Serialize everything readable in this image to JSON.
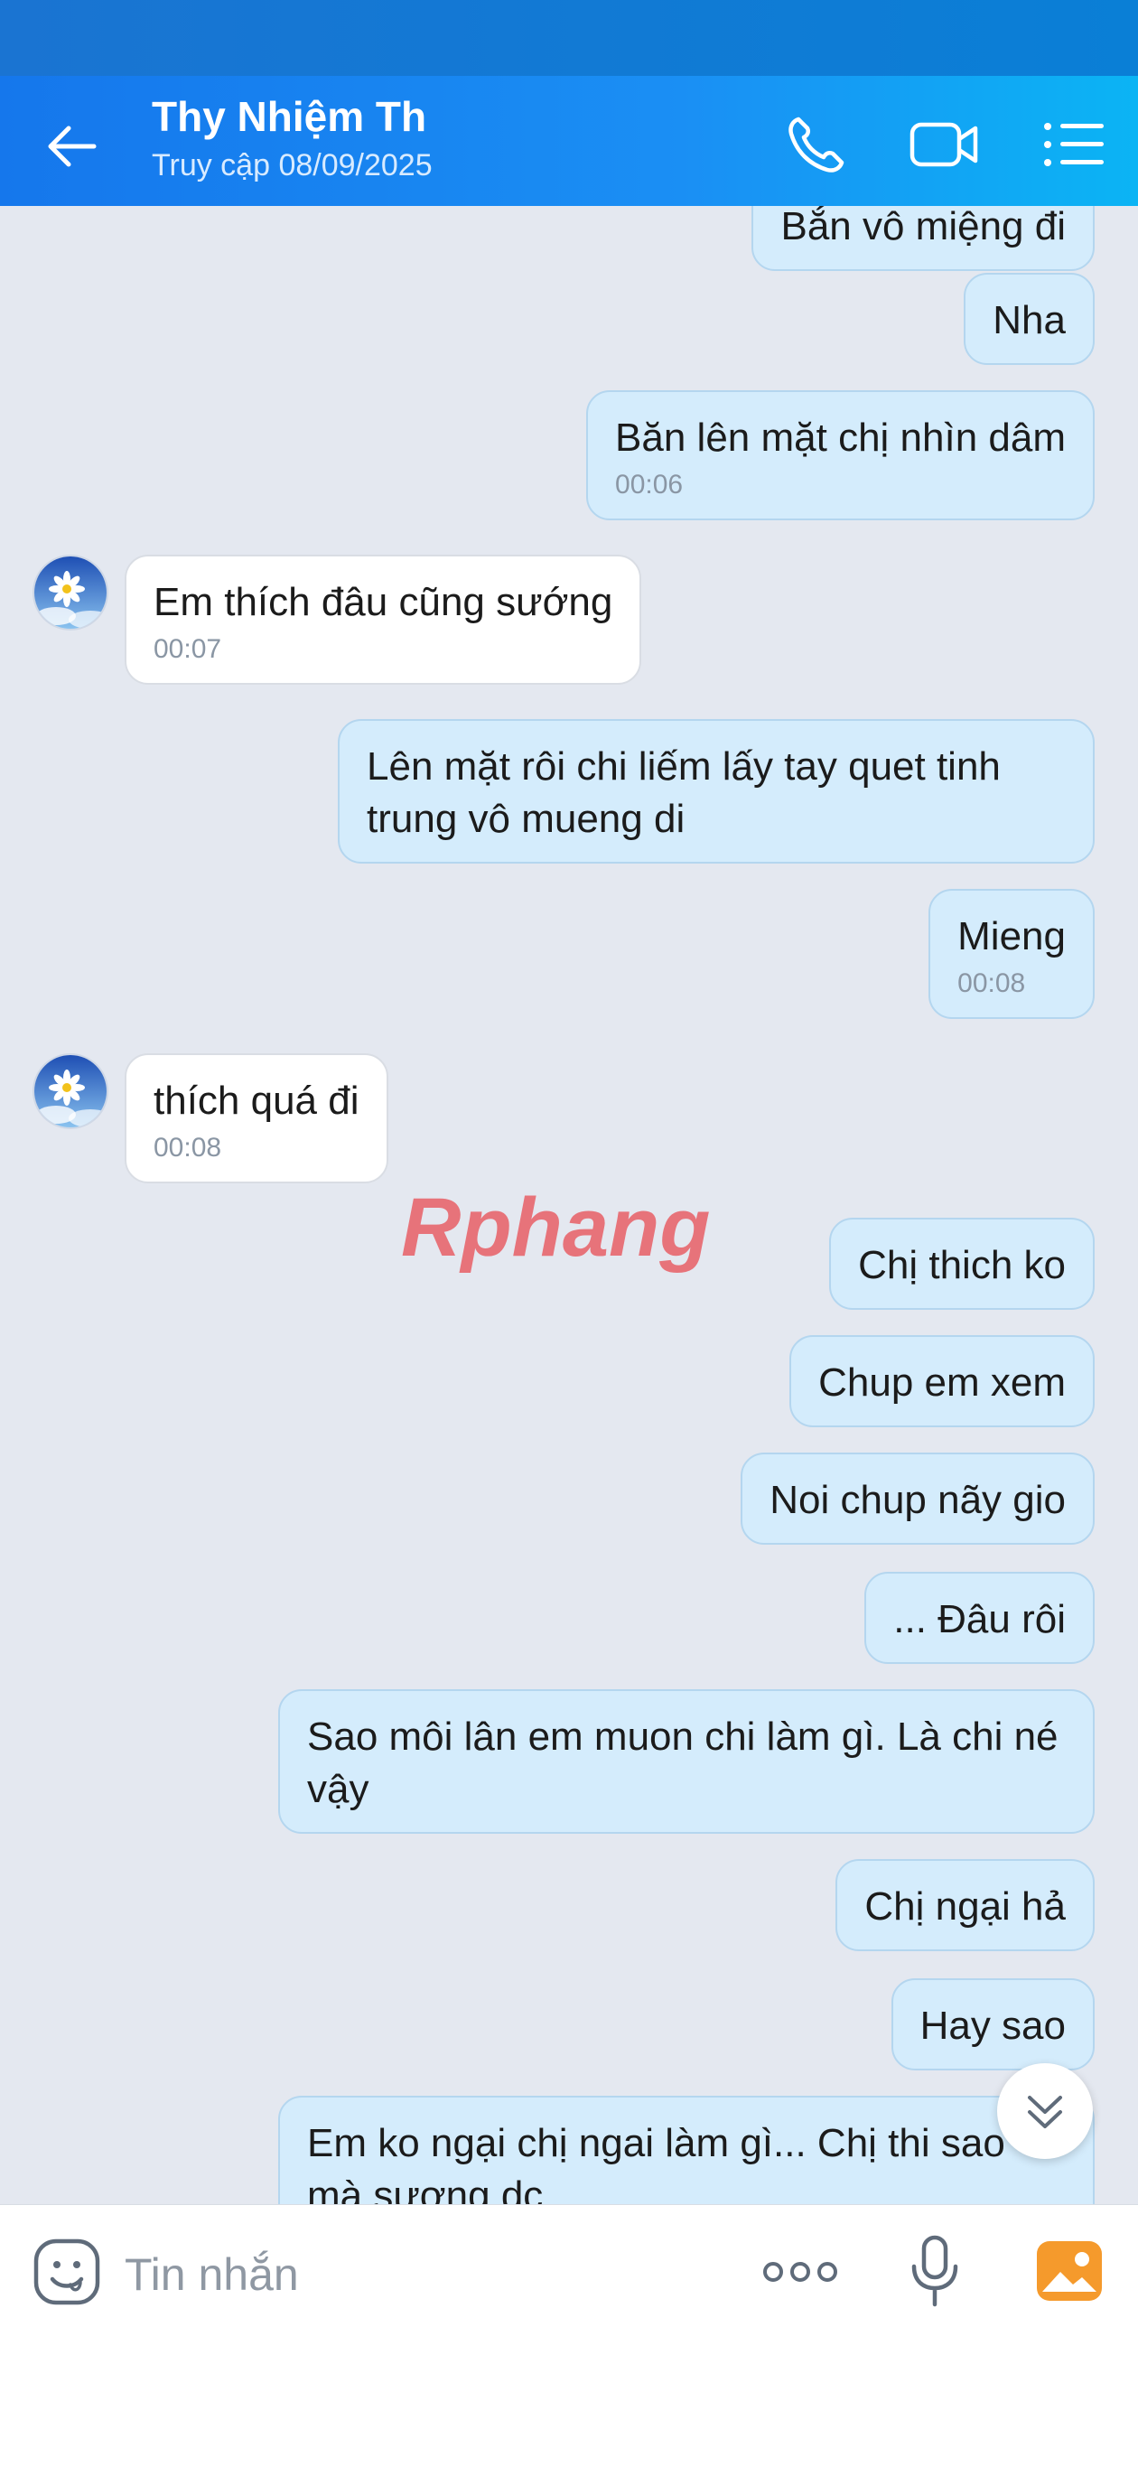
{
  "header": {
    "contact_name": "Thy Nhiệm Th",
    "last_seen": "Truy cập 08/09/2025"
  },
  "messages": [
    {
      "direction": "out",
      "text": "Bắn vô miệng đi",
      "time": ""
    },
    {
      "direction": "out",
      "text": "Nha",
      "time": ""
    },
    {
      "direction": "out",
      "text": "Băn lên mặt chị nhìn dâm",
      "time": "00:06"
    },
    {
      "direction": "in",
      "text": "Em thích đâu cũng sướng",
      "time": "00:07"
    },
    {
      "direction": "out",
      "text": "Lên mặt rôi chi liếm lấy tay quet tinh trung vô mueng di",
      "time": ""
    },
    {
      "direction": "out",
      "text": "Mieng",
      "time": "00:08"
    },
    {
      "direction": "in",
      "text": "thích quá đi",
      "time": "00:08"
    },
    {
      "direction": "out",
      "text": "Chị thich ko",
      "time": ""
    },
    {
      "direction": "out",
      "text": "Chup em xem",
      "time": ""
    },
    {
      "direction": "out",
      "text": "Noi chup nãy gio",
      "time": ""
    },
    {
      "direction": "out",
      "text": "... Đâu rôi",
      "time": ""
    },
    {
      "direction": "out",
      "text": "Sao môi lân em muon chi làm gì. Là chi né vậy",
      "time": ""
    },
    {
      "direction": "out",
      "text": "Chị ngại hả",
      "time": ""
    },
    {
      "direction": "out",
      "text": "Hay sao",
      "time": ""
    },
    {
      "direction": "out",
      "text": "Em ko ngại chị ngai làm gì... Chị thi sao mà sương dc",
      "time": ""
    }
  ],
  "watermark_text": "Rphang",
  "composer": {
    "placeholder": "Tin nhắn"
  },
  "icons": {
    "back": "back-arrow-icon",
    "call": "phone-icon",
    "video": "video-camera-icon",
    "menu": "list-menu-icon",
    "scroll_down": "double-chevron-down-icon",
    "sticker": "emoji-face-icon",
    "more": "more-dots-icon",
    "mic": "microphone-icon",
    "image": "gallery-image-icon"
  },
  "colors": {
    "header_start": "#1577ec",
    "header_end": "#0bb4f4",
    "chat_background": "#e4e8f0",
    "outgoing_bubble": "#d4ecfc",
    "incoming_bubble": "#ffffff",
    "image_button": "#f59a2c"
  }
}
